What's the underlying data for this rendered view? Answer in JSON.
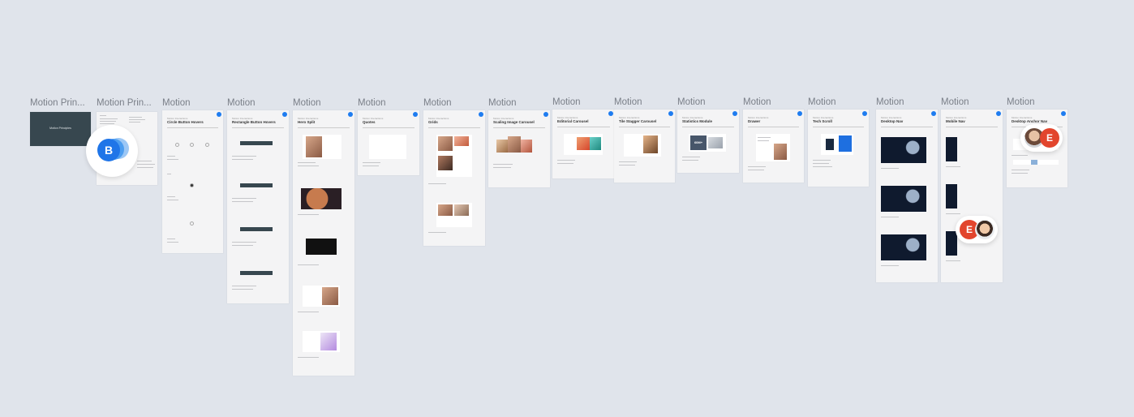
{
  "canvas": {
    "background": "#e0e4eb",
    "accent": "#1e7cf0"
  },
  "frames": [
    {
      "label": "Motion Prin...",
      "title": "",
      "caption": "",
      "cover_text": "Motion Principles"
    },
    {
      "label": "Motion Prin...",
      "title": "",
      "caption": ""
    },
    {
      "label": "Motion",
      "title": "Circle Button Hovers",
      "caption": "Motion Interactions"
    },
    {
      "label": "Motion",
      "title": "Rectangle Button Hovers",
      "caption": "Motion Interactions"
    },
    {
      "label": "Motion",
      "title": "Hero Split",
      "caption": "Motion Interactions"
    },
    {
      "label": "Motion",
      "title": "Quotes",
      "caption": "Motion Interactions"
    },
    {
      "label": "Motion",
      "title": "Grids",
      "caption": "Motion Interactions"
    },
    {
      "label": "Motion",
      "title": "Scaling Image Carousel",
      "caption": "Motion Interactions"
    },
    {
      "label": "Motion",
      "title": "Editorial Carousel",
      "caption": "Motion Interactions"
    },
    {
      "label": "Motion",
      "title": "Tile Stagger Carousel",
      "caption": "Motion Interactions"
    },
    {
      "label": "Motion",
      "title": "Statistics Module",
      "caption": "Motion Interactions",
      "stat_text": "60M+"
    },
    {
      "label": "Motion",
      "title": "Drawer",
      "caption": "Motion Interactions"
    },
    {
      "label": "Motion",
      "title": "Tech Scroll",
      "caption": "Motion Interactions"
    },
    {
      "label": "Motion",
      "title": "Desktop Nav",
      "caption": "Motion Interactions"
    },
    {
      "label": "Motion",
      "title": "Mobile Nav",
      "caption": "Motion Interactions"
    },
    {
      "label": "Motion",
      "title": "Desktop Anchor Nav",
      "caption": "Motion Interactions"
    }
  ],
  "collaborators": {
    "group_b": {
      "initial": "B",
      "color": "#1f75e8"
    },
    "user_e_1": {
      "initial": "E",
      "color": "#e2452d"
    },
    "user_e_2": {
      "initial": "E",
      "color": "#e2452d"
    }
  }
}
